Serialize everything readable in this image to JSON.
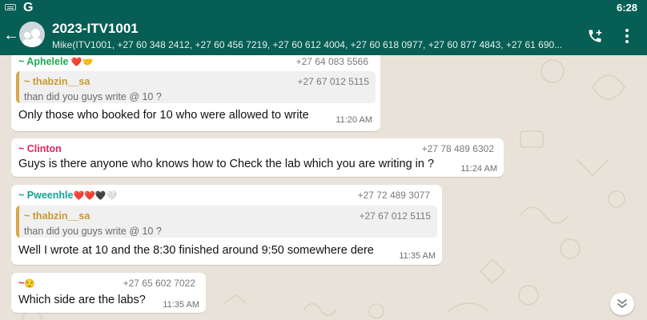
{
  "status_bar": {
    "time": "6:28",
    "app_letter": "G"
  },
  "header": {
    "back_glyph": "←",
    "title": "2023-ITV1001",
    "subtitle": "Mike(ITV1001, +27 60 348 2412, +27 60 456 7219, +27 60 612 4004, +27 60 618 0977, +27 60 877 4843, +27 61 690..."
  },
  "messages": [
    {
      "sender": "~ Aphelele",
      "sender_emoji": "❤️🤝",
      "phone": "+27 64 083 5566",
      "sender_color": "#1fa855",
      "partial": true,
      "quote": {
        "name": "~ thabzin__sa",
        "phone": "+27 67 012 5115",
        "text": "than did you guys write @ 10 ?"
      },
      "text": "Only those who booked for 10 who were allowed to write",
      "time": "11:20 AM"
    },
    {
      "sender": "~ Clinton",
      "phone": "+27 78 489 6302",
      "sender_color": "#e0245e",
      "text": "Guys is there anyone who knows how to Check the lab  which you are writing in ?",
      "time": "11:24 AM"
    },
    {
      "sender": "~ Pweenhle",
      "sender_emoji": "❤️❤️🖤🤍",
      "phone": "+27 72 489 3077",
      "sender_color": "#12a39a",
      "quote": {
        "name": "~ thabzin__sa",
        "phone": "+27 67 012 5115",
        "text": "than did you guys write @ 10 ?"
      },
      "text": "Well I wrote at 10 and the 8:30 finished around 9:50 somewhere dere",
      "time": "11:35 AM"
    },
    {
      "sender": "~",
      "sender_emoji": "😌",
      "phone": "+27 65 602 7022",
      "sender_color": "#e0245e",
      "text": "Which side  are the labs?",
      "time": "11:35 AM"
    }
  ],
  "colors": {
    "header_bg": "#075e54",
    "chat_bg": "#e9e2d8",
    "bubble_bg": "#ffffff",
    "quote_bar": "#d7a848"
  },
  "icons": [
    "keyboard-icon",
    "back-arrow-icon",
    "group-avatar-icon",
    "call-add-icon",
    "more-vert-icon",
    "scroll-down-icon"
  ]
}
